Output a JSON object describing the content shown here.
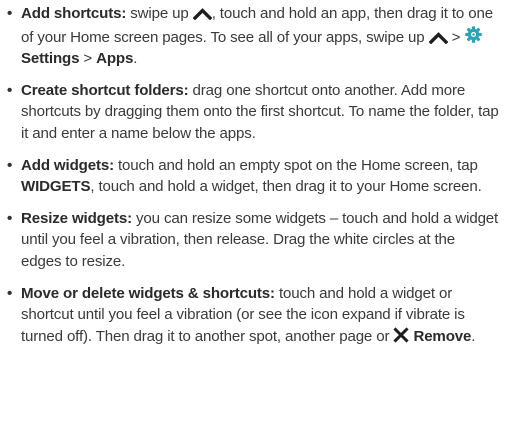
{
  "icons": {
    "swipe_up": "chevron-up-icon",
    "settings": "gear-icon",
    "remove": "close-icon"
  },
  "colors": {
    "text": "#3a3a3a",
    "settings_icon": "#2fa3b5"
  },
  "tips": [
    {
      "bullet": "•",
      "title": "Add shortcuts:",
      "t1": " swipe up ",
      "t2": ", touch and hold an app, then drag it to one of your Home screen pages. To see all of your apps, swipe up ",
      "t3": " > ",
      "settings": "Settings",
      "sep": " > ",
      "apps": "Apps",
      "end": "."
    },
    {
      "bullet": "•",
      "title": "Create shortcut folders:",
      "text": " drag one shortcut onto another. Add more shortcuts by dragging them onto the first shortcut. To name the folder, tap it and enter a name below the apps."
    },
    {
      "bullet": "•",
      "title": "Add widgets:",
      "t1": " touch and hold an empty spot on the Home screen, tap ",
      "widgets": "WIDGETS",
      "t2": ", touch and hold a widget, then drag it to your Home screen."
    },
    {
      "bullet": "•",
      "title": "Resize widgets:",
      "text": " you can resize some widgets – touch and hold a widget until you feel a vibration, then release. Drag the white circles at the edges to resize."
    },
    {
      "bullet": "•",
      "title": "Move or delete widgets & shortcuts:",
      "t1": " touch and hold a widget or shortcut until you feel a vibration (or see the icon expand if vibrate is turned off). Then drag it to another spot, another page or ",
      "remove": "Remove",
      "end": "."
    }
  ]
}
